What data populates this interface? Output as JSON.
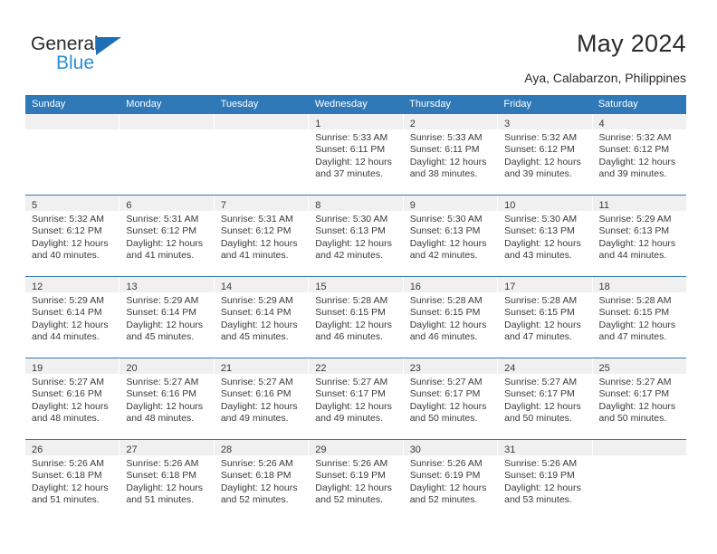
{
  "brand": {
    "name_part1": "General",
    "name_part2": "Blue",
    "triangle_icon": "blue-triangle-icon",
    "accent_dark": "#2b2b2b",
    "accent_blue": "#2b8fd4",
    "triangle_blue": "#1f6fb5"
  },
  "header": {
    "title": "May 2024",
    "subtitle": "Aya, Calabarzon, Philippines",
    "header_band_color": "#2f79b8",
    "date_strip_color": "#f0f0f0"
  },
  "calendar": {
    "weekday_headers": [
      "Sunday",
      "Monday",
      "Tuesday",
      "Wednesday",
      "Thursday",
      "Friday",
      "Saturday"
    ],
    "weeks": [
      [
        {
          "day": "",
          "lines": []
        },
        {
          "day": "",
          "lines": []
        },
        {
          "day": "",
          "lines": []
        },
        {
          "day": "1",
          "lines": [
            "Sunrise: 5:33 AM",
            "Sunset: 6:11 PM",
            "Daylight: 12 hours",
            "and 37 minutes."
          ]
        },
        {
          "day": "2",
          "lines": [
            "Sunrise: 5:33 AM",
            "Sunset: 6:11 PM",
            "Daylight: 12 hours",
            "and 38 minutes."
          ]
        },
        {
          "day": "3",
          "lines": [
            "Sunrise: 5:32 AM",
            "Sunset: 6:12 PM",
            "Daylight: 12 hours",
            "and 39 minutes."
          ]
        },
        {
          "day": "4",
          "lines": [
            "Sunrise: 5:32 AM",
            "Sunset: 6:12 PM",
            "Daylight: 12 hours",
            "and 39 minutes."
          ]
        }
      ],
      [
        {
          "day": "5",
          "lines": [
            "Sunrise: 5:32 AM",
            "Sunset: 6:12 PM",
            "Daylight: 12 hours",
            "and 40 minutes."
          ]
        },
        {
          "day": "6",
          "lines": [
            "Sunrise: 5:31 AM",
            "Sunset: 6:12 PM",
            "Daylight: 12 hours",
            "and 41 minutes."
          ]
        },
        {
          "day": "7",
          "lines": [
            "Sunrise: 5:31 AM",
            "Sunset: 6:12 PM",
            "Daylight: 12 hours",
            "and 41 minutes."
          ]
        },
        {
          "day": "8",
          "lines": [
            "Sunrise: 5:30 AM",
            "Sunset: 6:13 PM",
            "Daylight: 12 hours",
            "and 42 minutes."
          ]
        },
        {
          "day": "9",
          "lines": [
            "Sunrise: 5:30 AM",
            "Sunset: 6:13 PM",
            "Daylight: 12 hours",
            "and 42 minutes."
          ]
        },
        {
          "day": "10",
          "lines": [
            "Sunrise: 5:30 AM",
            "Sunset: 6:13 PM",
            "Daylight: 12 hours",
            "and 43 minutes."
          ]
        },
        {
          "day": "11",
          "lines": [
            "Sunrise: 5:29 AM",
            "Sunset: 6:13 PM",
            "Daylight: 12 hours",
            "and 44 minutes."
          ]
        }
      ],
      [
        {
          "day": "12",
          "lines": [
            "Sunrise: 5:29 AM",
            "Sunset: 6:14 PM",
            "Daylight: 12 hours",
            "and 44 minutes."
          ]
        },
        {
          "day": "13",
          "lines": [
            "Sunrise: 5:29 AM",
            "Sunset: 6:14 PM",
            "Daylight: 12 hours",
            "and 45 minutes."
          ]
        },
        {
          "day": "14",
          "lines": [
            "Sunrise: 5:29 AM",
            "Sunset: 6:14 PM",
            "Daylight: 12 hours",
            "and 45 minutes."
          ]
        },
        {
          "day": "15",
          "lines": [
            "Sunrise: 5:28 AM",
            "Sunset: 6:15 PM",
            "Daylight: 12 hours",
            "and 46 minutes."
          ]
        },
        {
          "day": "16",
          "lines": [
            "Sunrise: 5:28 AM",
            "Sunset: 6:15 PM",
            "Daylight: 12 hours",
            "and 46 minutes."
          ]
        },
        {
          "day": "17",
          "lines": [
            "Sunrise: 5:28 AM",
            "Sunset: 6:15 PM",
            "Daylight: 12 hours",
            "and 47 minutes."
          ]
        },
        {
          "day": "18",
          "lines": [
            "Sunrise: 5:28 AM",
            "Sunset: 6:15 PM",
            "Daylight: 12 hours",
            "and 47 minutes."
          ]
        }
      ],
      [
        {
          "day": "19",
          "lines": [
            "Sunrise: 5:27 AM",
            "Sunset: 6:16 PM",
            "Daylight: 12 hours",
            "and 48 minutes."
          ]
        },
        {
          "day": "20",
          "lines": [
            "Sunrise: 5:27 AM",
            "Sunset: 6:16 PM",
            "Daylight: 12 hours",
            "and 48 minutes."
          ]
        },
        {
          "day": "21",
          "lines": [
            "Sunrise: 5:27 AM",
            "Sunset: 6:16 PM",
            "Daylight: 12 hours",
            "and 49 minutes."
          ]
        },
        {
          "day": "22",
          "lines": [
            "Sunrise: 5:27 AM",
            "Sunset: 6:17 PM",
            "Daylight: 12 hours",
            "and 49 minutes."
          ]
        },
        {
          "day": "23",
          "lines": [
            "Sunrise: 5:27 AM",
            "Sunset: 6:17 PM",
            "Daylight: 12 hours",
            "and 50 minutes."
          ]
        },
        {
          "day": "24",
          "lines": [
            "Sunrise: 5:27 AM",
            "Sunset: 6:17 PM",
            "Daylight: 12 hours",
            "and 50 minutes."
          ]
        },
        {
          "day": "25",
          "lines": [
            "Sunrise: 5:27 AM",
            "Sunset: 6:17 PM",
            "Daylight: 12 hours",
            "and 50 minutes."
          ]
        }
      ],
      [
        {
          "day": "26",
          "lines": [
            "Sunrise: 5:26 AM",
            "Sunset: 6:18 PM",
            "Daylight: 12 hours",
            "and 51 minutes."
          ]
        },
        {
          "day": "27",
          "lines": [
            "Sunrise: 5:26 AM",
            "Sunset: 6:18 PM",
            "Daylight: 12 hours",
            "and 51 minutes."
          ]
        },
        {
          "day": "28",
          "lines": [
            "Sunrise: 5:26 AM",
            "Sunset: 6:18 PM",
            "Daylight: 12 hours",
            "and 52 minutes."
          ]
        },
        {
          "day": "29",
          "lines": [
            "Sunrise: 5:26 AM",
            "Sunset: 6:19 PM",
            "Daylight: 12 hours",
            "and 52 minutes."
          ]
        },
        {
          "day": "30",
          "lines": [
            "Sunrise: 5:26 AM",
            "Sunset: 6:19 PM",
            "Daylight: 12 hours",
            "and 52 minutes."
          ]
        },
        {
          "day": "31",
          "lines": [
            "Sunrise: 5:26 AM",
            "Sunset: 6:19 PM",
            "Daylight: 12 hours",
            "and 53 minutes."
          ]
        },
        {
          "day": "",
          "lines": []
        }
      ]
    ]
  }
}
